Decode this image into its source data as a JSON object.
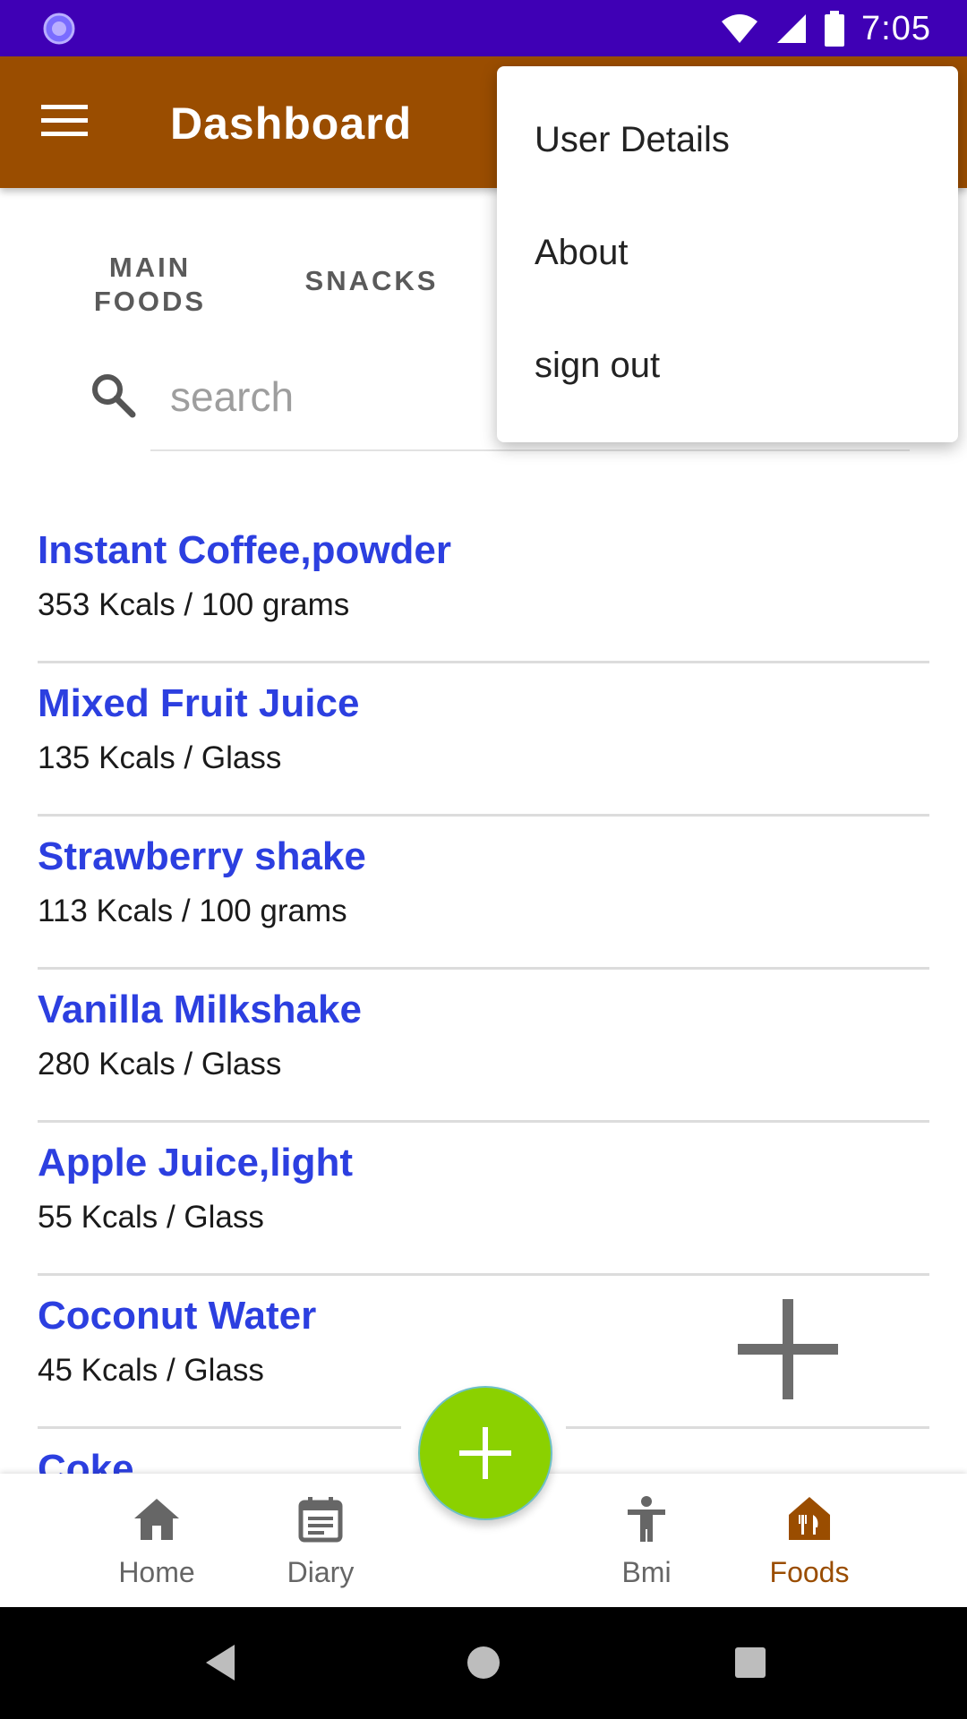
{
  "status_bar": {
    "time": "7:05"
  },
  "app_bar": {
    "title": "Dashboard"
  },
  "tabs": [
    {
      "label": "MAIN FOODS"
    },
    {
      "label": "SNACKS"
    }
  ],
  "search": {
    "placeholder": "search",
    "value": ""
  },
  "foods": [
    {
      "name": "Instant Coffee,powder",
      "kcal": "353 Kcals / 100 grams"
    },
    {
      "name": "Mixed Fruit Juice",
      "kcal": "135 Kcals / Glass"
    },
    {
      "name": "Strawberry shake",
      "kcal": "113 Kcals / 100 grams"
    },
    {
      "name": "Vanilla Milkshake",
      "kcal": "280 Kcals / Glass"
    },
    {
      "name": "Apple Juice,light",
      "kcal": "55 Kcals / Glass"
    },
    {
      "name": "Coconut Water",
      "kcal": "45 Kcals / Glass"
    },
    {
      "name": "Coke",
      "kcal": ""
    }
  ],
  "popup_menu": {
    "items": [
      "User Details",
      "About",
      "sign out"
    ]
  },
  "bottom_nav": {
    "items": [
      {
        "label": "Home",
        "icon": "home-icon"
      },
      {
        "label": "Diary",
        "icon": "diary-icon"
      },
      {
        "label": "Bmi",
        "icon": "person-icon"
      },
      {
        "label": "Foods",
        "icon": "foods-icon",
        "active": true
      }
    ]
  },
  "colors": {
    "status_bar": "#3f00b5",
    "app_bar": "#9a4d00",
    "food_name": "#2c3fe0",
    "fab": "#8bd100",
    "active_nav": "#9a4d00"
  }
}
